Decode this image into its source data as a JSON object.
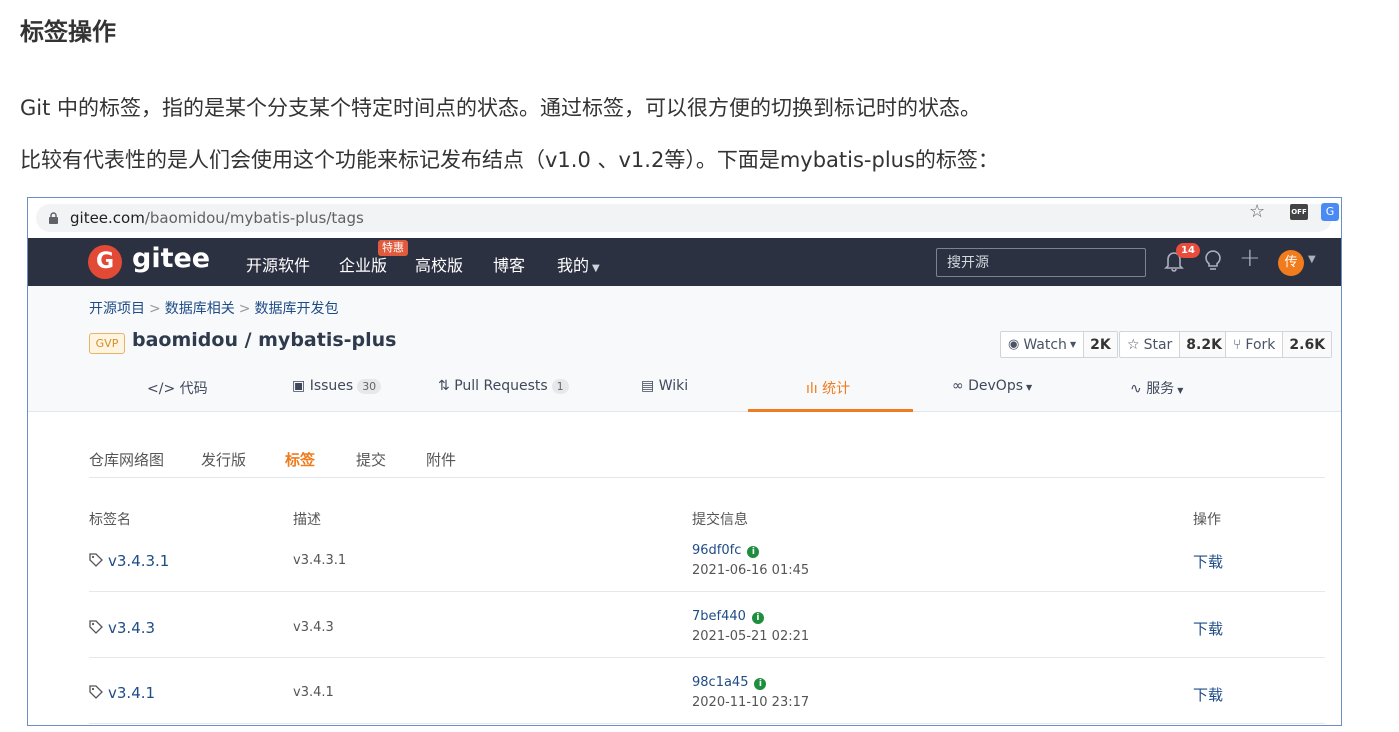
{
  "doc": {
    "title": "标签操作",
    "para1": "Git 中的标签，指的是某个分支某个特定时间点的状态。通过标签，可以很方便的切换到标记时的状态。",
    "para2": "比较有代表性的是人们会使用这个功能来标记发布结点（v1.0 、v1.2等）。下面是mybatis-plus的标签："
  },
  "browser": {
    "url_host": "gitee.com",
    "url_path": "/baomidou/mybatis-plus/tags",
    "ext_off_label": "OFF"
  },
  "nav": {
    "logo_letter": "G",
    "logo_text": "gitee",
    "items": [
      "开源软件",
      "企业版",
      "高校版",
      "博客",
      "我的"
    ],
    "enterprise_badge": "特惠",
    "search_placeholder": "搜开源",
    "notification_count": "14",
    "avatar_text": "传"
  },
  "breadcrumb": [
    "开源项目",
    "数据库相关",
    "数据库开发包"
  ],
  "repo": {
    "badge": "GVP",
    "name": "baomidou / mybatis-plus",
    "watch": {
      "label": "Watch",
      "count": "2K"
    },
    "star": {
      "label": "Star",
      "count": "8.2K"
    },
    "fork": {
      "label": "Fork",
      "count": "2.6K"
    }
  },
  "tabs": {
    "code": "代码",
    "issues": "Issues",
    "issues_count": "30",
    "pr": "Pull Requests",
    "pr_count": "1",
    "wiki": "Wiki",
    "stats": "统计",
    "devops": "DevOps",
    "service": "服务"
  },
  "subtabs": [
    "仓库网络图",
    "发行版",
    "标签",
    "提交",
    "附件"
  ],
  "active_subtab": "标签",
  "table": {
    "headers": [
      "标签名",
      "描述",
      "提交信息",
      "操作"
    ],
    "rows": [
      {
        "tag": "v3.4.3.1",
        "desc": "v3.4.3.1",
        "sha": "96df0fc",
        "date": "2021-06-16 01:45",
        "action": "下载"
      },
      {
        "tag": "v3.4.3",
        "desc": "v3.4.3",
        "sha": "7bef440",
        "date": "2021-05-21 02:21",
        "action": "下载"
      },
      {
        "tag": "v3.4.1",
        "desc": "v3.4.1",
        "sha": "98c1a45",
        "date": "2020-11-10 23:17",
        "action": "下载"
      }
    ]
  },
  "colors": {
    "accent": "#f07c1e",
    "nav_bg": "#2c3142",
    "link": "#1f4c87",
    "verified": "#1e8e3e"
  }
}
